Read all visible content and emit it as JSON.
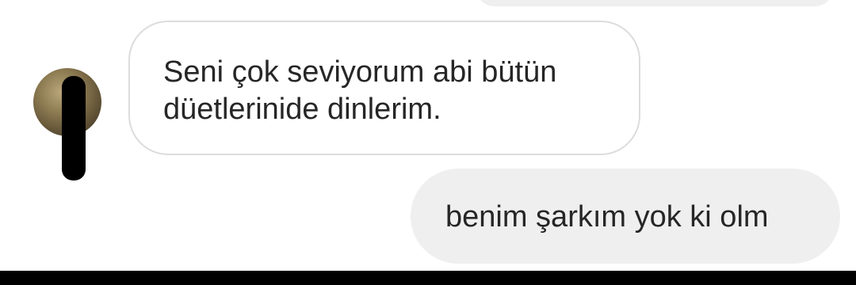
{
  "conversation": {
    "messages": [
      {
        "direction": "incoming",
        "lines": [
          "Seni çok seviyorum abi bütün",
          "düetlerinide dinlerim."
        ]
      },
      {
        "direction": "outgoing",
        "text": "benim şarkım yok ki olm"
      }
    ]
  },
  "colors": {
    "background": "#ffffff",
    "incoming_bubble_border": "#dcdcdc",
    "outgoing_bubble": "#efefef",
    "text": "#262626",
    "bottom_bar": "#000000"
  },
  "icons": {
    "sender_avatar": "avatar",
    "redaction": "black-marker-scribble"
  }
}
